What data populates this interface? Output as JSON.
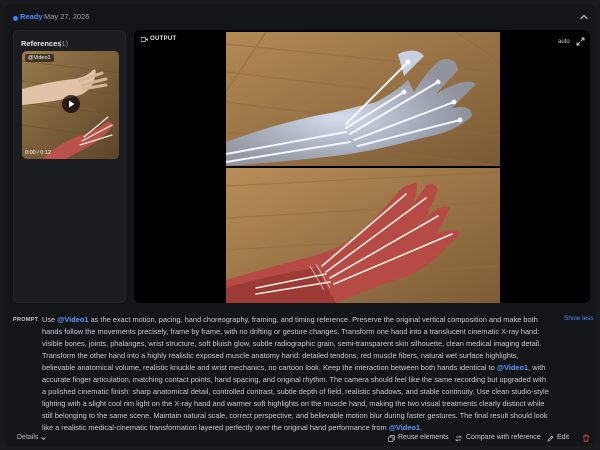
{
  "header": {
    "status": "Ready",
    "date": "May 27, 2026"
  },
  "references": {
    "title": "References",
    "count": "(1)",
    "thumbnail": {
      "tag": "@Video1",
      "time": "0:00 / 0:12"
    }
  },
  "output": {
    "label": "OUTPUT",
    "quality": "auto"
  },
  "prompt": {
    "label": "PROMPT",
    "show_less": "Show less",
    "segments": [
      {
        "text": "Use ",
        "mention": false
      },
      {
        "text": "@Video1",
        "mention": true
      },
      {
        "text": " as the exact motion, pacing, hand choreography, framing, and timing reference. Preserve the original vertical composition and make both hands follow the movements precisely, frame by frame, with no drifting or gesture changes. Transform one hand into a translucent cinematic X-ray hand: visible bones, joints, phalanges, wrist structure, soft bluish glow, subtle radiographic grain, semi-transparent skin silhouette, clean medical imaging detail. Transform the other hand into a highly realistic exposed muscle anatomy hand: detailed tendons, red muscle fibers, natural wet surface highlights, believable anatomical volume, realistic knuckle and wrist mechanics, no cartoon look. Keep the interaction between both hands identical to ",
        "mention": false
      },
      {
        "text": "@Video1",
        "mention": true
      },
      {
        "text": ", with accurate finger articulation, matching contact points, hand spacing, and original rhythm. The camera should feel like the same recording but upgraded with a polished cinematic finish: sharp anatomical detail, controlled contrast, subtle depth of field, realistic shadows, and stable continuity. Use clean studio-style lighting with a slight cool rim light on the X-ray hand and warmer soft highlights on the muscle hand, making the two visual treatments clearly distinct while still belonging to the same scene. Maintain natural scale, correct perspective, and believable motion blur during faster gestures. The final result should look like a realistic medical-cinematic transformation layered perfectly over the original hand performance from ",
        "mention": false
      },
      {
        "text": "@Video1",
        "mention": true
      },
      {
        "text": ".",
        "mention": false
      }
    ]
  },
  "footer": {
    "details": "Details",
    "reuse": "Reuse elements",
    "compare": "Compare with reference",
    "edit": "Edit"
  },
  "icons": {
    "collapse": "chevron-up-icon",
    "expand": "fullscreen-icon",
    "play": "play-icon",
    "video": "video-camera-icon",
    "details": "chevron-down-icon",
    "reuse": "copy-icon",
    "compare": "compare-icon",
    "edit": "pencil-icon",
    "delete": "trash-icon"
  },
  "colors": {
    "accent": "#4f8ef7",
    "danger": "#e5484d",
    "background": "#141519"
  }
}
